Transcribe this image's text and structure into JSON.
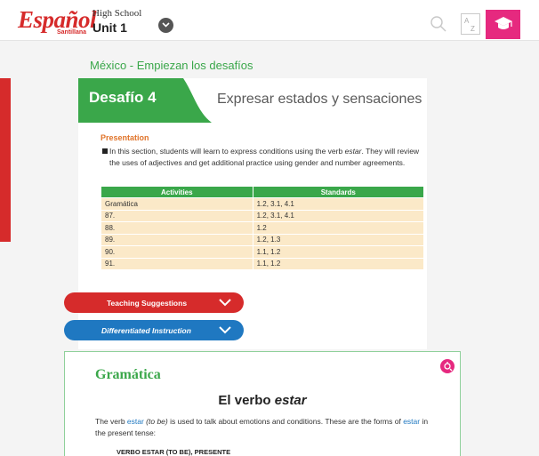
{
  "header": {
    "logo_text": "Español",
    "logo_sub": "Santillana",
    "level": "High School",
    "unit": "Unit 1",
    "az_top": "A",
    "az_bottom": "Z"
  },
  "section": {
    "title": "México - Empiezan los desafíos",
    "desafio_label": "Desafío 4",
    "desafio_subtitle": "Expresar estados y sensaciones"
  },
  "presentation": {
    "heading": "Presentation",
    "text_pre": "In this section, students will learn to express conditions using the verb ",
    "text_em": "estar",
    "text_post": ". They will review the uses of adjectives and get additional practice using gender and number agreements."
  },
  "table": {
    "headers": [
      "Activities",
      "Standards"
    ],
    "rows": [
      [
        "Gramática",
        "1.2, 3.1, 4.1"
      ],
      [
        "87.",
        "1.2, 3.1, 4.1"
      ],
      [
        "88.",
        "1.2"
      ],
      [
        "89.",
        "1.2, 1.3"
      ],
      [
        "90.",
        "1.1, 1.2"
      ],
      [
        "91.",
        "1.1, 1.2"
      ]
    ]
  },
  "pills": {
    "teaching": "Teaching Suggestions",
    "differentiated": "Differentiated Instruction"
  },
  "card": {
    "title": "Gramática",
    "heading_pre": "El verbo ",
    "heading_em": "estar",
    "text_1": "The verb ",
    "text_estar": "estar",
    "text_2": " (to be)",
    "text_3": " is used to talk about emotions and conditions. These are the forms of ",
    "text_estar2": "estar",
    "text_4": " in the present tense:",
    "footer": "VERBO ESTAR (TO BE), PRESENTE"
  },
  "colors": {
    "brand_red": "#d62b2b",
    "green": "#3aa74a",
    "pink": "#e6297f",
    "blue": "#1f78c1",
    "orange": "#e0742a",
    "table_cell": "#fbe9c8"
  }
}
